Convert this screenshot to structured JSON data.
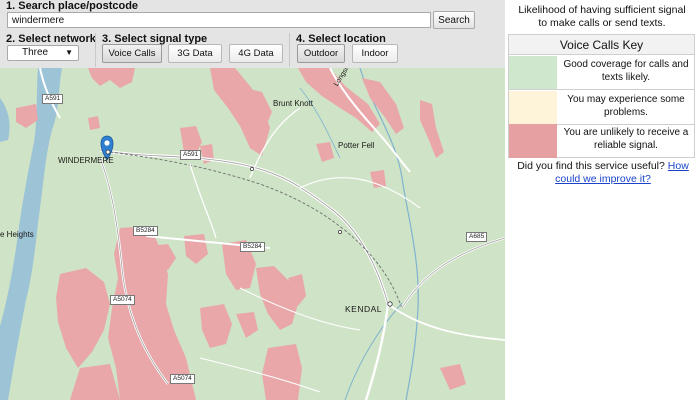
{
  "steps": {
    "search": {
      "label": "1. Search place/postcode",
      "value": "windermere",
      "button": "Search"
    },
    "network": {
      "label": "2. Select network",
      "selected": "Three"
    },
    "signal": {
      "label": "3. Select signal type",
      "options": [
        "Voice Calls",
        "3G Data",
        "4G Data"
      ],
      "selected": "Voice Calls"
    },
    "location": {
      "label": "4. Select location",
      "options": [
        "Outdoor",
        "Indoor"
      ],
      "selected": "Outdoor"
    }
  },
  "map": {
    "places": {
      "windermere": "WINDERMERE",
      "brunt_knott": "Brunt Knott",
      "potter_fell": "Potter Fell",
      "kendal": "KENDAL",
      "heights": "e Heights",
      "longsleddale": "Longsleddale"
    },
    "roads": {
      "a591_west": "A591",
      "a591_mid": "A591",
      "b5284_a": "B5284",
      "b5284_b": "B5284",
      "a5074_a": "A5074",
      "a5074_b": "A5074",
      "a685": "A685"
    },
    "colors": {
      "water": "#9cc3d6",
      "good": "#cfe3c6",
      "poor": "#e9a7aa"
    }
  },
  "key": {
    "intro": "Likelihood of having sufficient signal to make calls or send texts.",
    "title": "Voice Calls Key",
    "rows": [
      {
        "color": "#cfe7cd",
        "text": "Good coverage for calls and texts likely."
      },
      {
        "color": "#fdf4d9",
        "text": "You may experience some problems."
      },
      {
        "color": "#e6a0a2",
        "text": "You are unlikely to receive a reliable signal."
      }
    ]
  },
  "feedback": {
    "question": "Did you find this service useful?",
    "link": "How could we improve it?"
  }
}
